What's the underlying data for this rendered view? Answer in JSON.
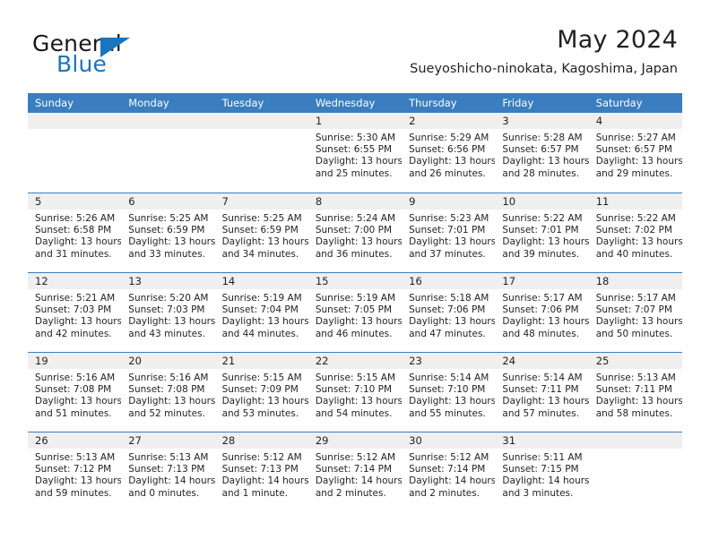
{
  "brand": {
    "name_part1": "General",
    "name_part2": "Blue",
    "accent_color": "#1b75bc"
  },
  "header": {
    "title": "May 2024",
    "subtitle": "Sueyoshicho-ninokata, Kagoshima, Japan"
  },
  "theme": {
    "header_blue": "#3a7ebf",
    "daynum_band": "#efefef",
    "text": "#231f20"
  },
  "weekdays": [
    "Sunday",
    "Monday",
    "Tuesday",
    "Wednesday",
    "Thursday",
    "Friday",
    "Saturday"
  ],
  "weeks": [
    [
      {
        "day": "",
        "sunrise": "",
        "sunset": "",
        "daylight_line1": "",
        "daylight_line2": ""
      },
      {
        "day": "",
        "sunrise": "",
        "sunset": "",
        "daylight_line1": "",
        "daylight_line2": ""
      },
      {
        "day": "",
        "sunrise": "",
        "sunset": "",
        "daylight_line1": "",
        "daylight_line2": ""
      },
      {
        "day": "1",
        "sunrise": "Sunrise: 5:30 AM",
        "sunset": "Sunset: 6:55 PM",
        "daylight_line1": "Daylight: 13 hours",
        "daylight_line2": "and 25 minutes."
      },
      {
        "day": "2",
        "sunrise": "Sunrise: 5:29 AM",
        "sunset": "Sunset: 6:56 PM",
        "daylight_line1": "Daylight: 13 hours",
        "daylight_line2": "and 26 minutes."
      },
      {
        "day": "3",
        "sunrise": "Sunrise: 5:28 AM",
        "sunset": "Sunset: 6:57 PM",
        "daylight_line1": "Daylight: 13 hours",
        "daylight_line2": "and 28 minutes."
      },
      {
        "day": "4",
        "sunrise": "Sunrise: 5:27 AM",
        "sunset": "Sunset: 6:57 PM",
        "daylight_line1": "Daylight: 13 hours",
        "daylight_line2": "and 29 minutes."
      }
    ],
    [
      {
        "day": "5",
        "sunrise": "Sunrise: 5:26 AM",
        "sunset": "Sunset: 6:58 PM",
        "daylight_line1": "Daylight: 13 hours",
        "daylight_line2": "and 31 minutes."
      },
      {
        "day": "6",
        "sunrise": "Sunrise: 5:25 AM",
        "sunset": "Sunset: 6:59 PM",
        "daylight_line1": "Daylight: 13 hours",
        "daylight_line2": "and 33 minutes."
      },
      {
        "day": "7",
        "sunrise": "Sunrise: 5:25 AM",
        "sunset": "Sunset: 6:59 PM",
        "daylight_line1": "Daylight: 13 hours",
        "daylight_line2": "and 34 minutes."
      },
      {
        "day": "8",
        "sunrise": "Sunrise: 5:24 AM",
        "sunset": "Sunset: 7:00 PM",
        "daylight_line1": "Daylight: 13 hours",
        "daylight_line2": "and 36 minutes."
      },
      {
        "day": "9",
        "sunrise": "Sunrise: 5:23 AM",
        "sunset": "Sunset: 7:01 PM",
        "daylight_line1": "Daylight: 13 hours",
        "daylight_line2": "and 37 minutes."
      },
      {
        "day": "10",
        "sunrise": "Sunrise: 5:22 AM",
        "sunset": "Sunset: 7:01 PM",
        "daylight_line1": "Daylight: 13 hours",
        "daylight_line2": "and 39 minutes."
      },
      {
        "day": "11",
        "sunrise": "Sunrise: 5:22 AM",
        "sunset": "Sunset: 7:02 PM",
        "daylight_line1": "Daylight: 13 hours",
        "daylight_line2": "and 40 minutes."
      }
    ],
    [
      {
        "day": "12",
        "sunrise": "Sunrise: 5:21 AM",
        "sunset": "Sunset: 7:03 PM",
        "daylight_line1": "Daylight: 13 hours",
        "daylight_line2": "and 42 minutes."
      },
      {
        "day": "13",
        "sunrise": "Sunrise: 5:20 AM",
        "sunset": "Sunset: 7:03 PM",
        "daylight_line1": "Daylight: 13 hours",
        "daylight_line2": "and 43 minutes."
      },
      {
        "day": "14",
        "sunrise": "Sunrise: 5:19 AM",
        "sunset": "Sunset: 7:04 PM",
        "daylight_line1": "Daylight: 13 hours",
        "daylight_line2": "and 44 minutes."
      },
      {
        "day": "15",
        "sunrise": "Sunrise: 5:19 AM",
        "sunset": "Sunset: 7:05 PM",
        "daylight_line1": "Daylight: 13 hours",
        "daylight_line2": "and 46 minutes."
      },
      {
        "day": "16",
        "sunrise": "Sunrise: 5:18 AM",
        "sunset": "Sunset: 7:06 PM",
        "daylight_line1": "Daylight: 13 hours",
        "daylight_line2": "and 47 minutes."
      },
      {
        "day": "17",
        "sunrise": "Sunrise: 5:17 AM",
        "sunset": "Sunset: 7:06 PM",
        "daylight_line1": "Daylight: 13 hours",
        "daylight_line2": "and 48 minutes."
      },
      {
        "day": "18",
        "sunrise": "Sunrise: 5:17 AM",
        "sunset": "Sunset: 7:07 PM",
        "daylight_line1": "Daylight: 13 hours",
        "daylight_line2": "and 50 minutes."
      }
    ],
    [
      {
        "day": "19",
        "sunrise": "Sunrise: 5:16 AM",
        "sunset": "Sunset: 7:08 PM",
        "daylight_line1": "Daylight: 13 hours",
        "daylight_line2": "and 51 minutes."
      },
      {
        "day": "20",
        "sunrise": "Sunrise: 5:16 AM",
        "sunset": "Sunset: 7:08 PM",
        "daylight_line1": "Daylight: 13 hours",
        "daylight_line2": "and 52 minutes."
      },
      {
        "day": "21",
        "sunrise": "Sunrise: 5:15 AM",
        "sunset": "Sunset: 7:09 PM",
        "daylight_line1": "Daylight: 13 hours",
        "daylight_line2": "and 53 minutes."
      },
      {
        "day": "22",
        "sunrise": "Sunrise: 5:15 AM",
        "sunset": "Sunset: 7:10 PM",
        "daylight_line1": "Daylight: 13 hours",
        "daylight_line2": "and 54 minutes."
      },
      {
        "day": "23",
        "sunrise": "Sunrise: 5:14 AM",
        "sunset": "Sunset: 7:10 PM",
        "daylight_line1": "Daylight: 13 hours",
        "daylight_line2": "and 55 minutes."
      },
      {
        "day": "24",
        "sunrise": "Sunrise: 5:14 AM",
        "sunset": "Sunset: 7:11 PM",
        "daylight_line1": "Daylight: 13 hours",
        "daylight_line2": "and 57 minutes."
      },
      {
        "day": "25",
        "sunrise": "Sunrise: 5:13 AM",
        "sunset": "Sunset: 7:11 PM",
        "daylight_line1": "Daylight: 13 hours",
        "daylight_line2": "and 58 minutes."
      }
    ],
    [
      {
        "day": "26",
        "sunrise": "Sunrise: 5:13 AM",
        "sunset": "Sunset: 7:12 PM",
        "daylight_line1": "Daylight: 13 hours",
        "daylight_line2": "and 59 minutes."
      },
      {
        "day": "27",
        "sunrise": "Sunrise: 5:13 AM",
        "sunset": "Sunset: 7:13 PM",
        "daylight_line1": "Daylight: 14 hours",
        "daylight_line2": "and 0 minutes."
      },
      {
        "day": "28",
        "sunrise": "Sunrise: 5:12 AM",
        "sunset": "Sunset: 7:13 PM",
        "daylight_line1": "Daylight: 14 hours",
        "daylight_line2": "and 1 minute."
      },
      {
        "day": "29",
        "sunrise": "Sunrise: 5:12 AM",
        "sunset": "Sunset: 7:14 PM",
        "daylight_line1": "Daylight: 14 hours",
        "daylight_line2": "and 2 minutes."
      },
      {
        "day": "30",
        "sunrise": "Sunrise: 5:12 AM",
        "sunset": "Sunset: 7:14 PM",
        "daylight_line1": "Daylight: 14 hours",
        "daylight_line2": "and 2 minutes."
      },
      {
        "day": "31",
        "sunrise": "Sunrise: 5:11 AM",
        "sunset": "Sunset: 7:15 PM",
        "daylight_line1": "Daylight: 14 hours",
        "daylight_line2": "and 3 minutes."
      },
      {
        "day": "",
        "sunrise": "",
        "sunset": "",
        "daylight_line1": "",
        "daylight_line2": ""
      }
    ]
  ]
}
